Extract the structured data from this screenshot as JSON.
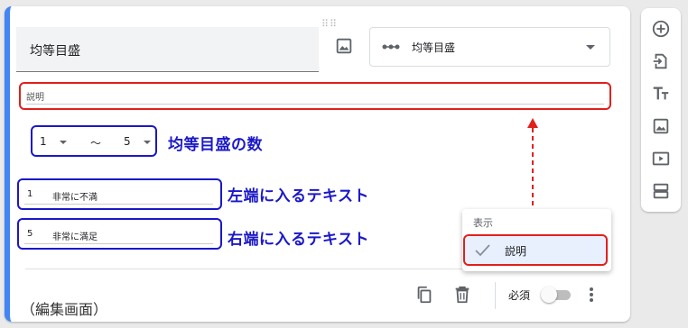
{
  "question": {
    "title": "均等目盛",
    "type_label": "均等目盛",
    "description_placeholder": "説明"
  },
  "scale": {
    "min": "1",
    "separator": "〜",
    "max": "5"
  },
  "labels": [
    {
      "num": "1",
      "text": "非常に不満"
    },
    {
      "num": "5",
      "text": "非常に満足"
    }
  ],
  "annotations": {
    "scale_count": "均等目盛の数",
    "left_text": "左端に入るテキスト",
    "right_text": "右端に入るテキスト",
    "footer": "（編集画面）"
  },
  "footer": {
    "required_label": "必須",
    "required_on": false
  },
  "popup": {
    "header": "表示",
    "item_label": "説明",
    "item_checked": true
  },
  "sidebar": {
    "icons": [
      "add-question-icon",
      "import-question-icon",
      "add-title-icon",
      "add-image-icon",
      "add-video-icon",
      "add-section-icon"
    ]
  },
  "colors": {
    "accent": "#4285f4",
    "highlight_red": "#e0201c",
    "highlight_blue": "#1a18c8"
  }
}
